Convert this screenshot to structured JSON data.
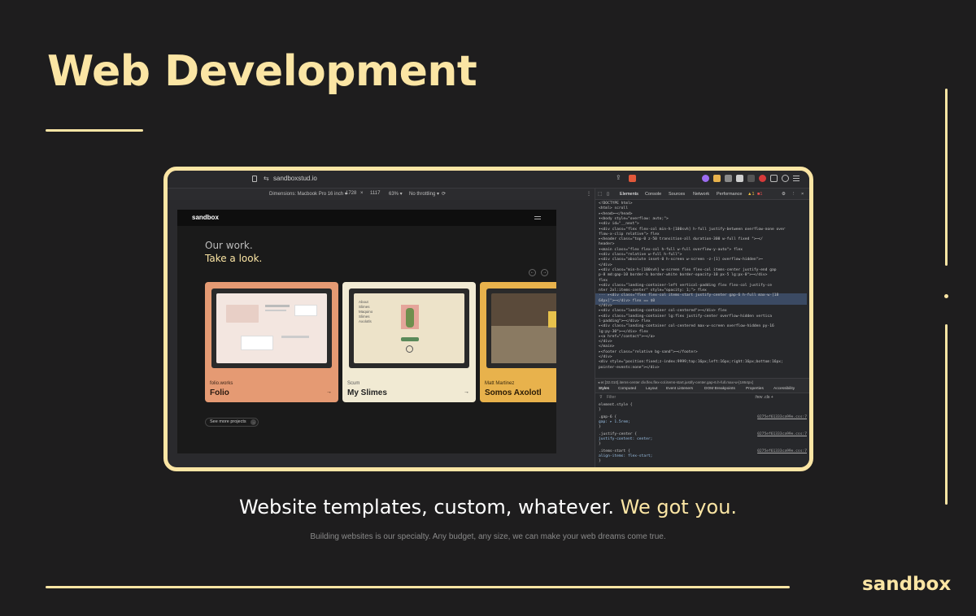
{
  "page": {
    "title": "Web Development",
    "tagline_main": "Website templates, custom, whatever.",
    "tagline_accent": "We got you.",
    "subtagline": "Building websites is our specialty. Any budget, any size, we can make your web dreams come true.",
    "brand": "sandbox"
  },
  "colors": {
    "accent": "#fbe5a4",
    "background": "#1e1d1e"
  },
  "browser": {
    "url": "sandboxstud.io",
    "device_bar": {
      "dimensions": "Dimensions: Macbook Pro 16 inch ▾",
      "width": "1728",
      "times": "×",
      "height": "1117",
      "zoom": "63% ▾",
      "throttle": "No throttling ▾"
    }
  },
  "site": {
    "logo": "sandbox",
    "heading_line1": "Our work.",
    "heading_line2": "Take a look.",
    "prev": "←",
    "next": "→",
    "cards": [
      {
        "owner": "folio.works",
        "name": "Folio",
        "arrow": "→",
        "bg": "#e59a73"
      },
      {
        "owner": "Scum",
        "name": "My Slimes",
        "arrow": "→",
        "bg": "#f1ead3"
      },
      {
        "owner": "Matt Martinez",
        "name": "Somos Axolotl",
        "arrow": "→",
        "bg": "#e8b24c"
      }
    ],
    "see_more": "See more projects"
  },
  "devtools": {
    "tabs": [
      "Elements",
      "Console",
      "Sources",
      "Network",
      "Performance"
    ],
    "warning_count": "▲1",
    "error_count": "■1",
    "dom_lines": [
      "<!DOCTYPE html>",
      "<html> scroll",
      "  ▸<head>⋯</head>",
      "  ▾<body style=\"overflow: auto;\">",
      "    ▾<div id=\"__next\">",
      "      ▾<div class=\"flex flex-col min-h-[100svh] h-full justify-between overflow-none over",
      "        flow-x-clip  relative\"> flex",
      "        ▸<header class=\"top-0 z-50 transition-all duration-300 w-full fixed \">⋯</",
      "        header>",
      "        ▾<main class=\"flex flex-col h-full w-full overflow-y-auto\"> flex",
      "          ▾<div class=\"relative w-full h-full\">",
      "            ▸<div class=\"absolute inset-0 h-screen w-screen -z-[1] overflow-hidden\">⋯",
      "            </div>",
      "            ▸<div class=\"min-h-[100svh] w-screen flex flex-col items-center justify-end gap",
      "            p-8 md:gap-10 border-b border-white border-opacity-10 px-5 lg:px-0\">⋯</div>",
      "             flex",
      "            ▾<div class=\"landing-container-left vertical-padding  flex flex-col justify-ce",
      "            nter 2xl:items-center\" style=\"opacity: 1;\"> flex",
      "···           ▸<div class=\"flex flex-col items-start justify-center gap-6 h-full max-w-[18",
      "              64px]\">⋯</div> flex == $0",
      "            </div>",
      "            ▸<div class=\"landing-container col-centered\">⋯</div> flex",
      "            ▸<div class=\"landing-container lg:flex justify-center overflow-hidden  vertica",
      "            l-padding\">⋯</div> flex",
      "            ▸<div class=\"landing-container col-centered max-w-screen overflow-hidden py-16",
      "            lg:py-30\">⋯</div> flex",
      "            ▸<a href=\"/contact\">⋯</a>",
      "          </div>",
      "        </main>",
      "        ▸<footer class=\"relative bg-sand\">⋯</footer>",
      "      </div>",
      "      <div style=\"position:fixed;z-index:9999;top:16px;left:16px;right:16px;bottom:16px;",
      "      pointer-events:none\"></div>"
    ],
    "breadcrumb": "◂ er.[32.010].items-center   div.flex.flex-col.items-start.justify-center.gap-6.h-full.max-w-[1864px]",
    "style_tabs": [
      "Styles",
      "Computed",
      "Layout",
      "Event Listeners",
      "DOM Breakpoints",
      "Properties",
      "Accessibility"
    ],
    "filter_placeholder": "Filter",
    "filter_tools": ":hov  .cls  +",
    "rules": [
      {
        "selector": "element.style {",
        "body": "",
        "close": "}",
        "source": ""
      },
      {
        "selector": ".gap-6 {",
        "body": "  gap: ▸ 1.5rem;",
        "close": "}",
        "source": "0275ef61333ca99e.css:7"
      },
      {
        "selector": ".justify-center {",
        "body": "  justify-content: center;",
        "close": "}",
        "source": "0275ef61333ca99e.css:7"
      },
      {
        "selector": ".items-start {",
        "body": "  align-items: flex-start;",
        "close": "}",
        "source": "0275ef61333ca99e.css:7"
      }
    ]
  }
}
